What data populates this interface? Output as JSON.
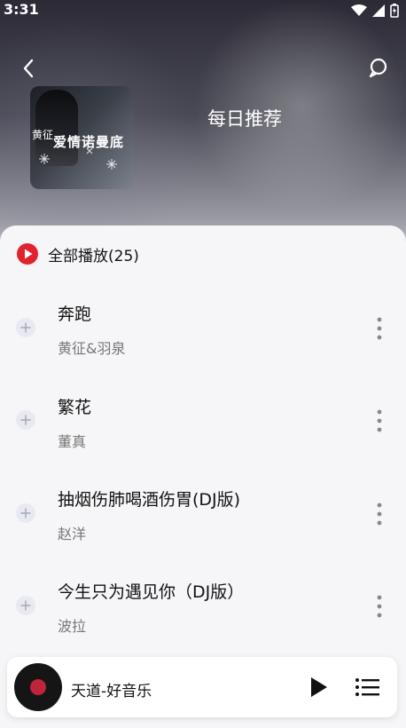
{
  "status_bar": {
    "time": "3:31"
  },
  "header": {
    "title": "每日推荐"
  },
  "cover": {
    "artist": "黄征",
    "album": "爱情诺曼底"
  },
  "play_all": {
    "label": "全部播放(25)"
  },
  "songs": [
    {
      "title": "奔跑",
      "artist": "黄征&羽泉"
    },
    {
      "title": "繁花",
      "artist": "董真"
    },
    {
      "title": "抽烟伤肺喝酒伤胃(DJ版)",
      "artist": "赵洋"
    },
    {
      "title": "今生只为遇见你（DJ版）",
      "artist": "波拉"
    }
  ],
  "mini_player": {
    "title": "天道-好音乐"
  },
  "colors": {
    "accent": "#e0232d",
    "text": "#111111",
    "subtext": "#777777"
  },
  "icons": {
    "back": "chevron-left-icon",
    "comment": "comment-icon",
    "play_all": "play-circle-icon",
    "add": "plus-icon",
    "more": "more-vertical-icon",
    "play": "play-icon",
    "playlist": "playlist-icon"
  }
}
